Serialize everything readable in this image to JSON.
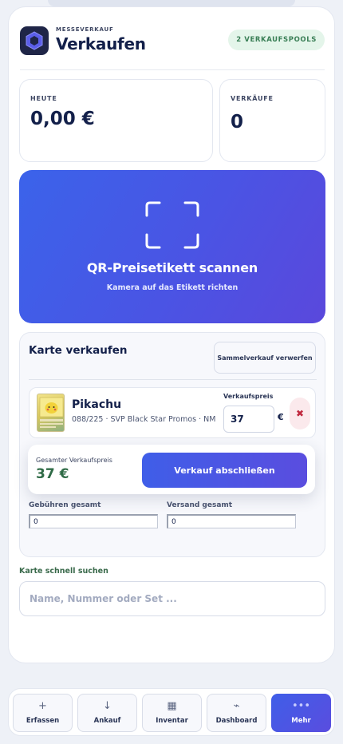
{
  "header": {
    "overline": "MESSEVERKAUF",
    "title": "Verkaufen",
    "pool_badge": "2 VERKAUFSPOOLS"
  },
  "stats": {
    "today_label": "HEUTE",
    "today_value": "0,00 €",
    "sales_label": "VERKÄUFE",
    "sales_value": "0"
  },
  "scan": {
    "title": "QR-Preisetikett scannen",
    "subtitle": "Kamera auf das Etikett richten"
  },
  "sell_card": {
    "title": "Karte verkaufen",
    "discard_label": "Sammelverkauf verwerfen",
    "item": {
      "name": "Pikachu",
      "meta": "088/225 · SVP Black Star Promos · NM",
      "price_label": "Verkaufspreis",
      "price_value": "37",
      "currency": "€",
      "remove_symbol": "✖"
    },
    "fees_label": "Gebühren gesamt",
    "fees_value": "0",
    "shipping_label": "Versand gesamt",
    "shipping_value": "0"
  },
  "total": {
    "label": "Gesamter Verkaufspreis",
    "value": "37 €",
    "checkout_label": "Verkauf abschließen"
  },
  "search": {
    "label": "Karte schnell suchen",
    "placeholder": "Name, Nummer oder Set ..."
  },
  "nav": [
    {
      "label": "Erfassen",
      "icon": "+",
      "icon_name": "plus-icon"
    },
    {
      "label": "Ankauf",
      "icon": "↓",
      "icon_name": "arrow-down-icon"
    },
    {
      "label": "Inventar",
      "icon": "▦",
      "icon_name": "grid-icon"
    },
    {
      "label": "Dashboard",
      "icon": "⌁",
      "icon_name": "pulse-icon"
    },
    {
      "label": "Mehr",
      "icon": "•••",
      "icon_name": "more-icon",
      "active": true
    }
  ],
  "colors": {
    "accent": "#4a54e4",
    "success": "#2f6b46",
    "danger": "#c0283e"
  }
}
